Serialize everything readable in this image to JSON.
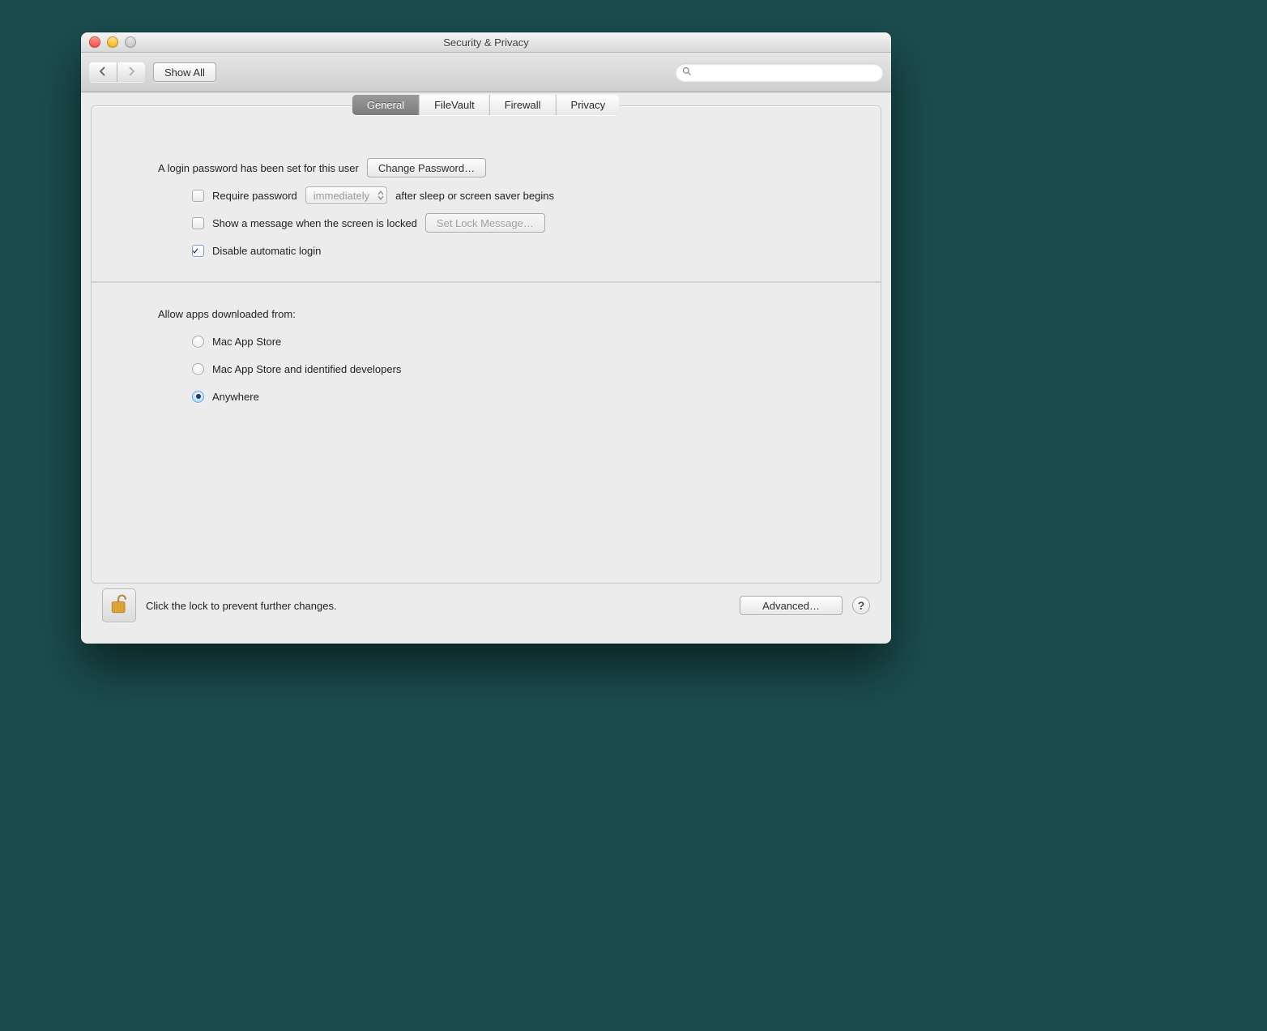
{
  "window": {
    "title": "Security & Privacy"
  },
  "toolbar": {
    "show_all": "Show All",
    "search_placeholder": ""
  },
  "tabs": [
    {
      "label": "General",
      "active": true
    },
    {
      "label": "FileVault",
      "active": false
    },
    {
      "label": "Firewall",
      "active": false
    },
    {
      "label": "Privacy",
      "active": false
    }
  ],
  "general": {
    "password_set_text": "A login password has been set for this user",
    "change_password_btn": "Change Password…",
    "require_password_label": "Require password",
    "require_password_checked": false,
    "delay_popup_value": "immediately",
    "after_sleep_text": "after sleep or screen saver begins",
    "show_message_label": "Show a message when the screen is locked",
    "show_message_checked": false,
    "set_lock_message_btn": "Set Lock Message…",
    "set_lock_message_enabled": false,
    "disable_auto_login_label": "Disable automatic login",
    "disable_auto_login_checked": true,
    "allow_apps_label": "Allow apps downloaded from:",
    "allow_apps_options": [
      {
        "label": "Mac App Store",
        "selected": false
      },
      {
        "label": "Mac App Store and identified developers",
        "selected": false
      },
      {
        "label": "Anywhere",
        "selected": true
      }
    ]
  },
  "footer": {
    "lock_text": "Click the lock to prevent further changes.",
    "advanced_btn": "Advanced…",
    "help_label": "?"
  }
}
